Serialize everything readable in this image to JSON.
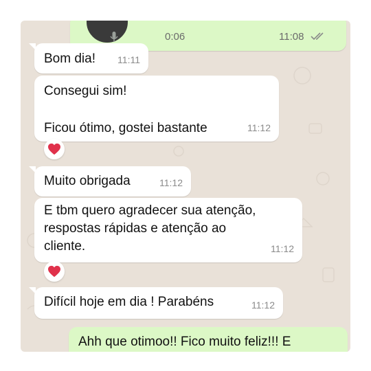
{
  "audio_message": {
    "duration": "0:06",
    "time": "11:08"
  },
  "messages": [
    {
      "text": "Bom dia!",
      "time": "11:11"
    },
    {
      "text": "Consegui sim!\n\nFicou ótimo, gostei bastante",
      "time": "11:12",
      "reaction": "red-heart"
    },
    {
      "text": "Muito obrigada",
      "time": "11:12"
    },
    {
      "text": "E tbm quero agradecer sua atenção,\nrespostas rápidas e atenção ao\ncliente.",
      "time": "11:12",
      "reaction": "red-heart"
    },
    {
      "text": "Difícil hoje em dia ! Parabéns",
      "time": "11:12"
    }
  ],
  "outgoing_partial": {
    "text": "Ahh que otimoo!! Fico muito feliz!!! E"
  },
  "colors": {
    "incoming": "#ffffff",
    "outgoing": "#dcf8c6",
    "background": "#e9e1d8",
    "heart": "#e0314b"
  }
}
